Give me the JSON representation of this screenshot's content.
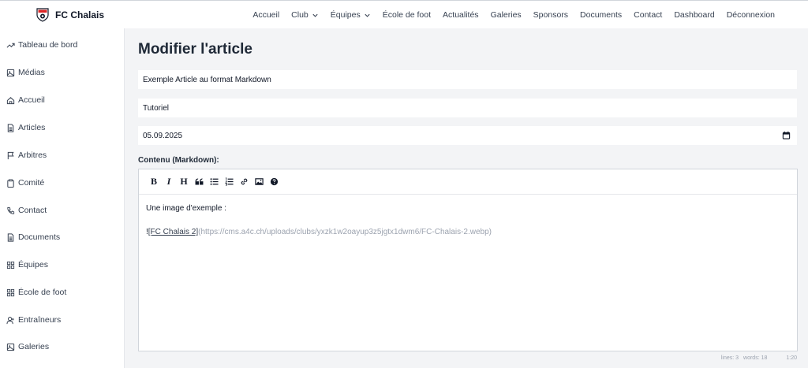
{
  "brand": {
    "name": "FC Chalais",
    "logo_icon": "club-crest-icon",
    "accent": "#dc2626"
  },
  "nav": [
    {
      "label": "Accueil"
    },
    {
      "label": "Club",
      "dropdown": true
    },
    {
      "label": "Équipes",
      "dropdown": true
    },
    {
      "label": "École de foot"
    },
    {
      "label": "Actualités"
    },
    {
      "label": "Galeries"
    },
    {
      "label": "Sponsors"
    },
    {
      "label": "Documents"
    },
    {
      "label": "Contact"
    },
    {
      "label": "Dashboard"
    },
    {
      "label": "Déconnexion"
    }
  ],
  "sidebar": {
    "items": [
      {
        "label": "Tableau de bord",
        "icon": "trending-up-icon"
      },
      {
        "label": "Médias",
        "icon": "image-icon"
      },
      {
        "label": "Accueil",
        "icon": "home-icon"
      },
      {
        "label": "Articles",
        "icon": "document-icon"
      },
      {
        "label": "Arbitres",
        "icon": "flag-icon"
      },
      {
        "label": "Comité",
        "icon": "clipboard-icon"
      },
      {
        "label": "Contact",
        "icon": "phone-icon"
      },
      {
        "label": "Documents",
        "icon": "document-icon"
      },
      {
        "label": "Équipes",
        "icon": "grid-icon"
      },
      {
        "label": "École de foot",
        "icon": "grid-icon"
      },
      {
        "label": "Entraîneurs",
        "icon": "user-icon"
      },
      {
        "label": "Galeries",
        "icon": "image-icon"
      }
    ]
  },
  "page": {
    "title": "Modifier l'article",
    "fields": {
      "title_value": "Exemple Article au format Markdown",
      "category_value": "Tutoriel",
      "date_value": "05.09.2025"
    },
    "content_label": "Contenu (Markdown):"
  },
  "editor": {
    "toolbar": [
      "bold",
      "italic",
      "heading",
      "quote",
      "unordered-list",
      "ordered-list",
      "link",
      "image",
      "help"
    ],
    "line1": "Une image d'exemple :",
    "line3_bang": "!",
    "line3_link": "[FC Chalais 2]",
    "line3_url": "(https://cms.a4c.ch/uploads/clubs/yxzk1w2oayup3z5jgtx1dwm6/FC-Chalais-2.webp)",
    "status": {
      "lines": "lines: 3",
      "words": "words: 18",
      "cursor": "1:20"
    }
  }
}
